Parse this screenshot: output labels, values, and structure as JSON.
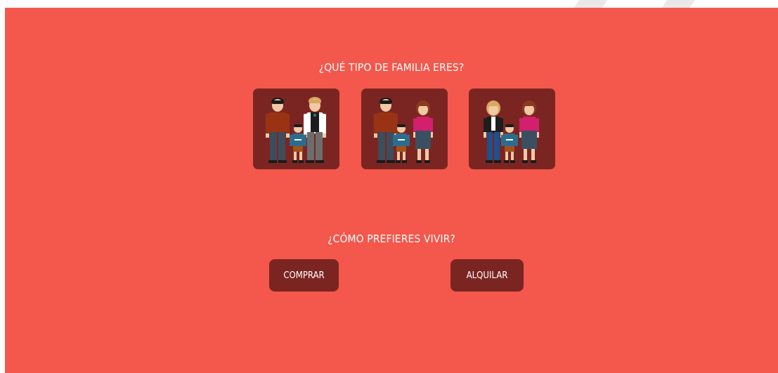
{
  "question_family": "¿QUÉ TIPO DE FAMILIA ERES?",
  "family_options": [
    {
      "icon": "family-two-dads-icon"
    },
    {
      "icon": "family-mom-dad-icon"
    },
    {
      "icon": "family-two-moms-icon"
    }
  ],
  "question_living": "¿CÓMO PREFIERES VIVIR?",
  "buttons": {
    "buy_label": "COMPRAR",
    "rent_label": "ALQUILAR"
  },
  "colors": {
    "background": "#f4574b",
    "card": "#7b2522",
    "text": "#ffffff"
  }
}
